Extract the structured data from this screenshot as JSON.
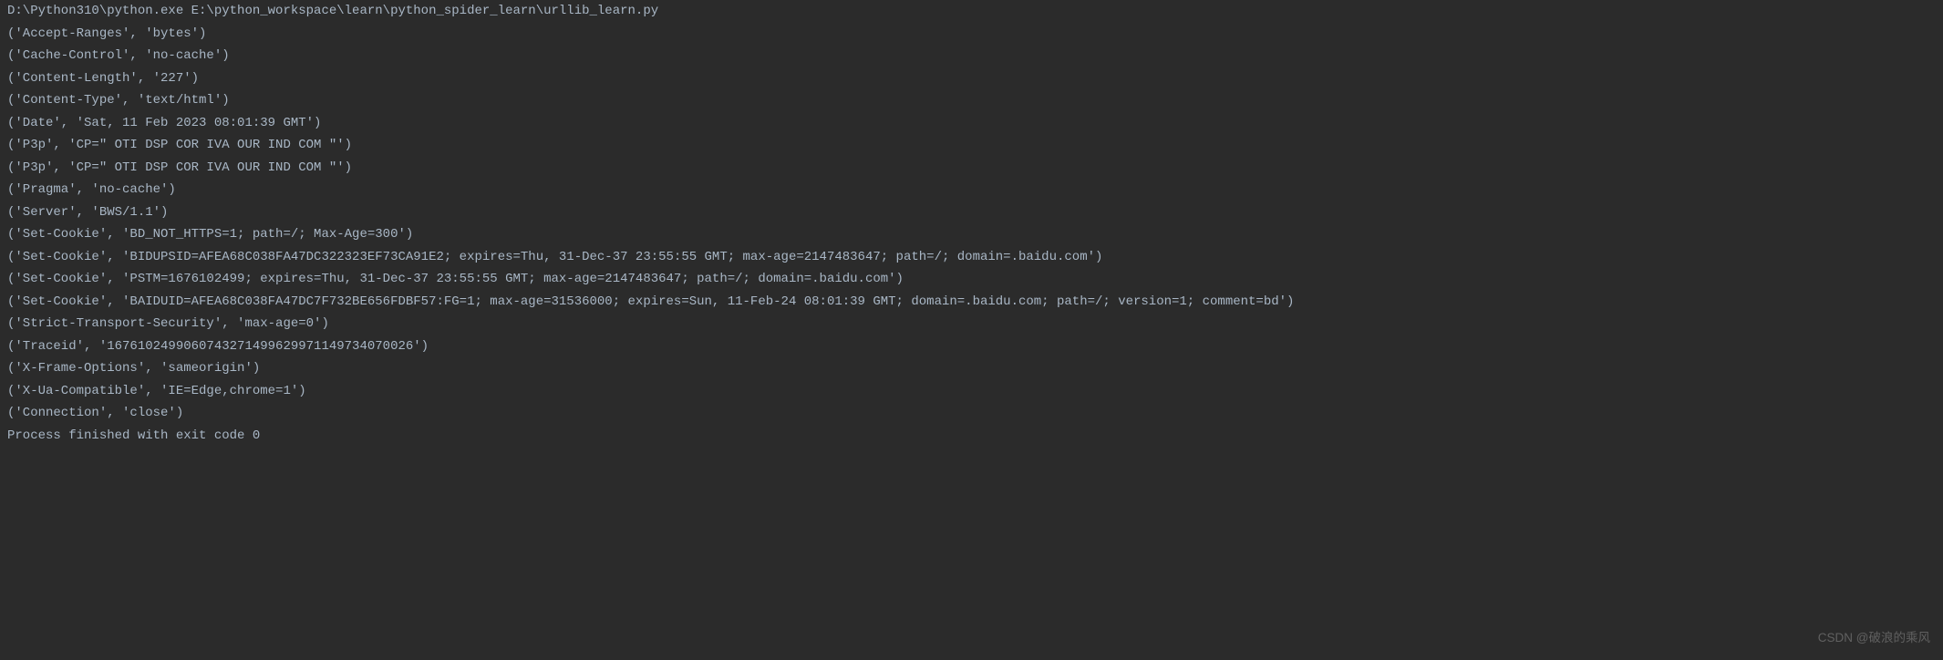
{
  "console": {
    "command": "D:\\Python310\\python.exe E:\\python_workspace\\learn\\python_spider_learn\\urllib_learn.py",
    "lines": [
      "('Accept-Ranges', 'bytes')",
      "('Cache-Control', 'no-cache')",
      "('Content-Length', '227')",
      "('Content-Type', 'text/html')",
      "('Date', 'Sat, 11 Feb 2023 08:01:39 GMT')",
      "('P3p', 'CP=\" OTI DSP COR IVA OUR IND COM \"')",
      "('P3p', 'CP=\" OTI DSP COR IVA OUR IND COM \"')",
      "('Pragma', 'no-cache')",
      "('Server', 'BWS/1.1')",
      "('Set-Cookie', 'BD_NOT_HTTPS=1; path=/; Max-Age=300')",
      "('Set-Cookie', 'BIDUPSID=AFEA68C038FA47DC322323EF73CA91E2; expires=Thu, 31-Dec-37 23:55:55 GMT; max-age=2147483647; path=/; domain=.baidu.com')",
      "('Set-Cookie', 'PSTM=1676102499; expires=Thu, 31-Dec-37 23:55:55 GMT; max-age=2147483647; path=/; domain=.baidu.com')",
      "('Set-Cookie', 'BAIDUID=AFEA68C038FA47DC7F732BE656FDBF57:FG=1; max-age=31536000; expires=Sun, 11-Feb-24 08:01:39 GMT; domain=.baidu.com; path=/; version=1; comment=bd')",
      "('Strict-Transport-Security', 'max-age=0')",
      "('Traceid', '1676102499060743271499629971149734070026')",
      "('X-Frame-Options', 'sameorigin')",
      "('X-Ua-Compatible', 'IE=Edge,chrome=1')",
      "('Connection', 'close')"
    ],
    "blank": "",
    "exit_message": "Process finished with exit code 0"
  },
  "watermark": "CSDN @破浪的乘风"
}
